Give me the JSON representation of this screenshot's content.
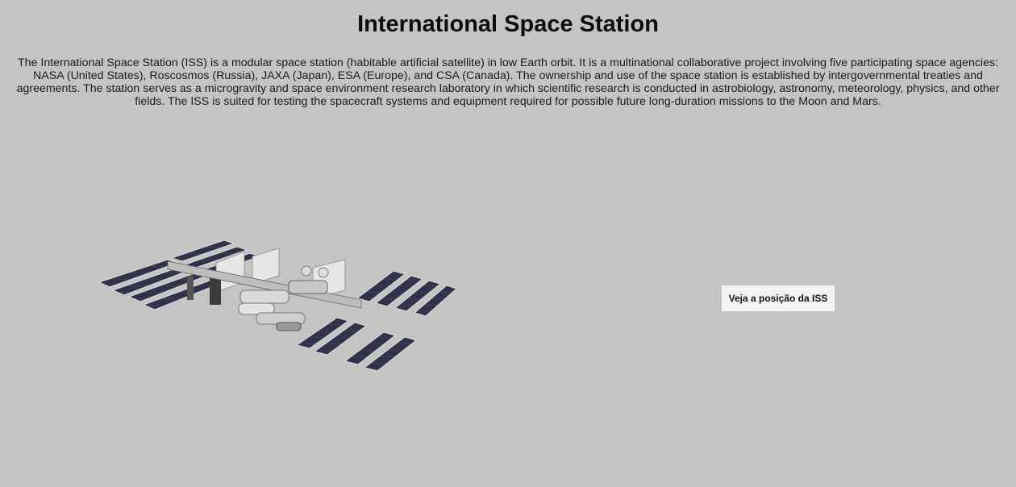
{
  "page": {
    "title": "International Space Station",
    "description": "The International Space Station (ISS) is a modular space station (habitable artificial satellite) in low Earth orbit. It is a multinational collaborative project involving five participating space agencies: NASA (United States), Roscosmos (Russia), JAXA (Japan), ESA (Europe), and CSA (Canada). The ownership and use of the space station is established by intergovernmental treaties and agreements. The station serves as a microgravity and space environment research laboratory in which scientific research is conducted in astrobiology, astronomy, meteorology, physics, and other fields. The ISS is suited for testing the spacecraft systems and equipment required for possible future long-duration missions to the Moon and Mars."
  },
  "iss_image": {
    "icon": "space-station-illustration"
  },
  "cta": {
    "label": "Veja a posição da ISS"
  },
  "colors": {
    "background": "#c4c5c2",
    "button_bg": "#f3f3f3",
    "solar_panel": "#2e3148"
  }
}
